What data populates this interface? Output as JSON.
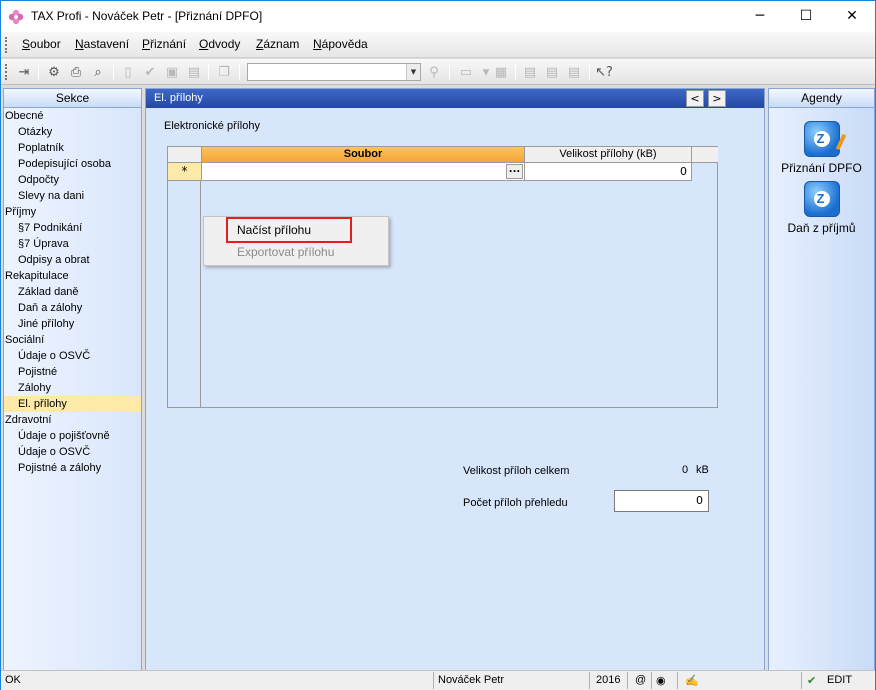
{
  "window": {
    "title": "TAX Profi - Nováček Petr - [Přiznání DPFO]",
    "minimize_glyph": "─",
    "maximize_glyph": "☐",
    "close_glyph": "✕"
  },
  "menu": [
    "Soubor",
    "Nastavení",
    "Přiznání",
    "Odvody",
    "Záznam",
    "Nápověda"
  ],
  "toolbar": {
    "combo_value": ""
  },
  "sekce": {
    "header": "Sekce",
    "items": [
      {
        "label": "Obecné",
        "type": "grp"
      },
      {
        "label": "Otázky",
        "type": "sub"
      },
      {
        "label": "Poplatník",
        "type": "sub"
      },
      {
        "label": "Podepisující osoba",
        "type": "sub"
      },
      {
        "label": "Odpočty",
        "type": "sub"
      },
      {
        "label": "Slevy na dani",
        "type": "sub"
      },
      {
        "label": "Příjmy",
        "type": "grp"
      },
      {
        "label": "§7 Podnikání",
        "type": "sub"
      },
      {
        "label": "§7 Úprava",
        "type": "sub"
      },
      {
        "label": "Odpisy a obrat",
        "type": "sub"
      },
      {
        "label": "Rekapitulace",
        "type": "grp"
      },
      {
        "label": "Základ daně",
        "type": "sub"
      },
      {
        "label": "Daň a zálohy",
        "type": "sub"
      },
      {
        "label": "Jiné přílohy",
        "type": "sub"
      },
      {
        "label": "Sociální",
        "type": "grp"
      },
      {
        "label": "Údaje o OSVČ",
        "type": "sub"
      },
      {
        "label": "Pojistné",
        "type": "sub"
      },
      {
        "label": "Zálohy",
        "type": "sub"
      },
      {
        "label": "El. přílohy",
        "type": "sub",
        "active": true
      },
      {
        "label": "Zdravotní",
        "type": "grp"
      },
      {
        "label": "Údaje o pojišťovně",
        "type": "sub"
      },
      {
        "label": "Údaje o OSVČ",
        "type": "sub"
      },
      {
        "label": "Pojistné a zálohy",
        "type": "sub"
      }
    ]
  },
  "main": {
    "header": "El. přílohy",
    "prev_glyph": "<",
    "next_glyph": ">",
    "section_title": "Elektronické přílohy",
    "grid": {
      "col_file": "Soubor",
      "col_size": "Velikost přílohy (kB)",
      "row_marker": "*",
      "row_file": "",
      "row_size": "0",
      "ellipsis": "..."
    },
    "context_menu": {
      "load": "Načíst přílohu",
      "export": "Exportovat přílohu"
    },
    "total_label": "Velikost příloh celkem",
    "total_value": "0",
    "total_unit": "kB",
    "count_label": "Počet příloh přehledu",
    "count_value": "0"
  },
  "agendy": {
    "header": "Agendy",
    "items": [
      {
        "label": "Přiznání DPFO"
      },
      {
        "label": "Daň z příjmů"
      }
    ]
  },
  "status": {
    "state": "OK",
    "user": "Nováček Petr",
    "year": "2016",
    "at": "@",
    "mode": "EDIT"
  }
}
